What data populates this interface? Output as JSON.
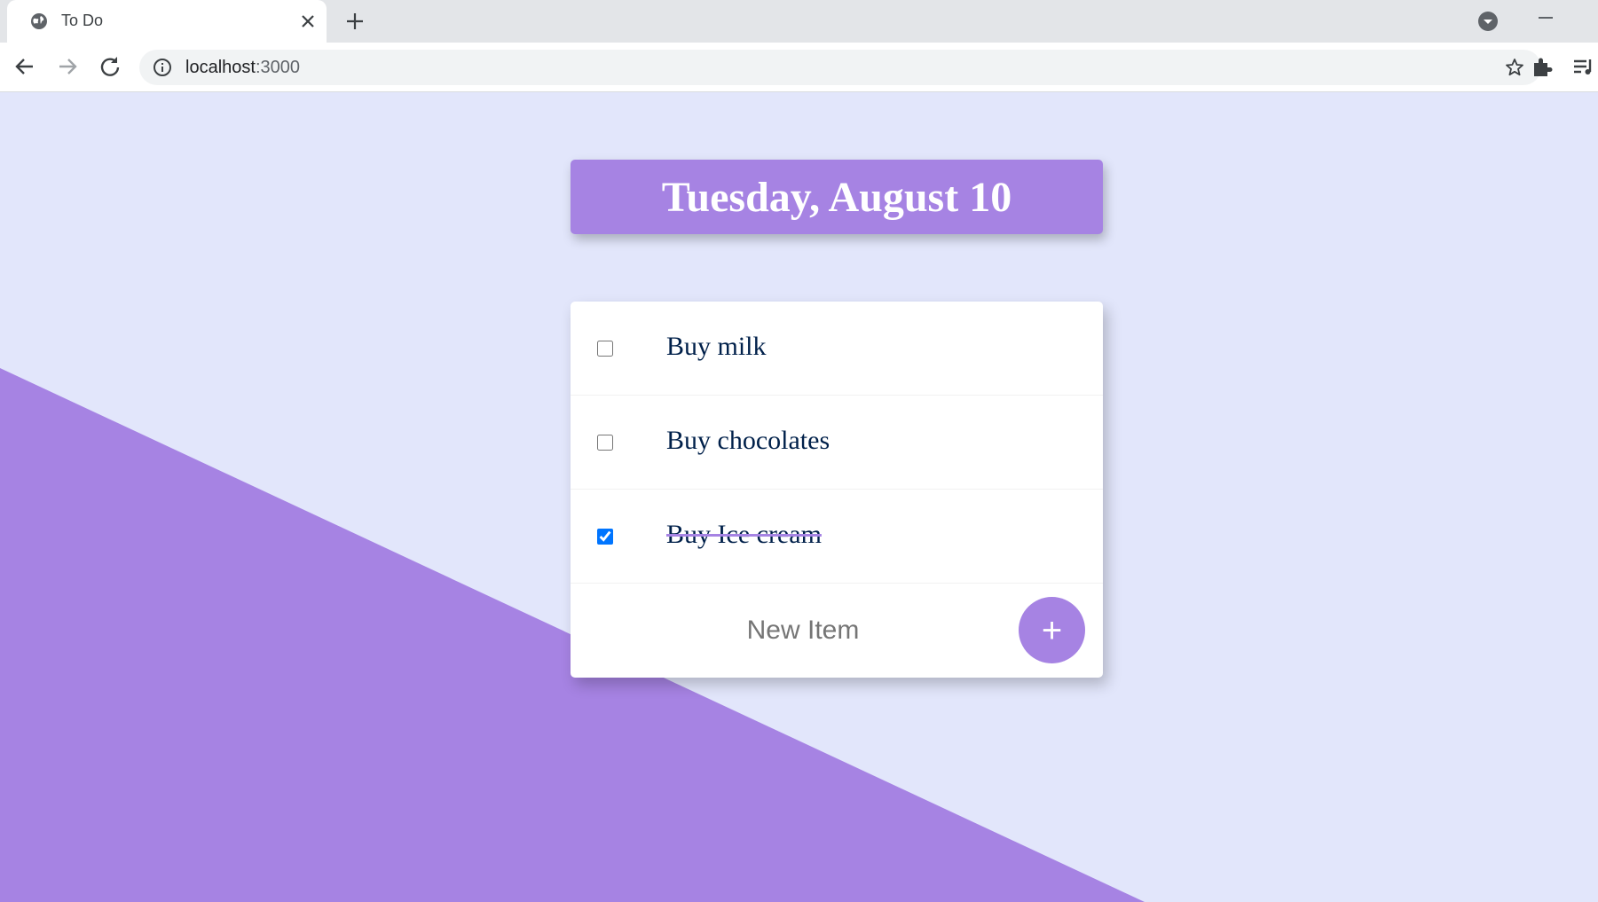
{
  "browser": {
    "tab_title": "To Do",
    "url_host": "localhost",
    "url_port": ":3000"
  },
  "page": {
    "heading": "Tuesday, August 10",
    "items": [
      {
        "label": "Buy milk",
        "checked": false
      },
      {
        "label": "Buy chocolates",
        "checked": false
      },
      {
        "label": "Buy Ice cream",
        "checked": true
      }
    ],
    "new_item_placeholder": "New Item",
    "add_button_label": "+"
  },
  "colors": {
    "background": "#E2E6FB",
    "accent": "#A683E3",
    "text": "#00204A"
  }
}
